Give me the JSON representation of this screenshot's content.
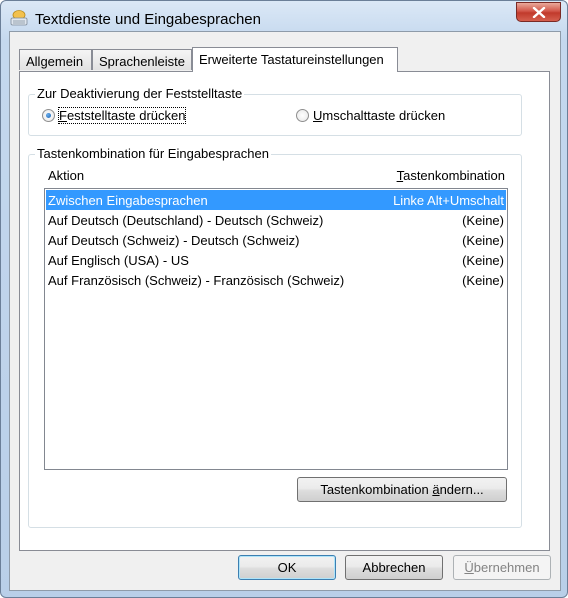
{
  "window": {
    "title": "Textdienste und Eingabesprachen"
  },
  "tabs": [
    {
      "label": "Allgemein",
      "active": false
    },
    {
      "label": "Sprachenleiste",
      "active": false
    },
    {
      "label": "Erweiterte Tastatureinstellungen",
      "active": true
    }
  ],
  "capslock_group": {
    "title": "Zur Deaktivierung der Feststelltaste",
    "option1": {
      "pre": "",
      "ul": "F",
      "post": "eststelltaste drücken",
      "selected": true
    },
    "option2": {
      "pre": "",
      "ul": "U",
      "post": "mschalttaste drücken",
      "selected": false
    }
  },
  "hotkey_group": {
    "title": "Tastenkombination für Eingabesprachen",
    "col_action": "Aktion",
    "col_key": {
      "ul": "T",
      "post": "astenkombination"
    },
    "rows": [
      {
        "action": "Zwischen Eingabesprachen",
        "key": "Linke Alt+Umschalt",
        "selected": true
      },
      {
        "action": "Auf Deutsch (Deutschland) - Deutsch (Schweiz)",
        "key": "(Keine)",
        "selected": false
      },
      {
        "action": "Auf Deutsch (Schweiz) - Deutsch (Schweiz)",
        "key": "(Keine)",
        "selected": false
      },
      {
        "action": "Auf Englisch (USA) - US",
        "key": "(Keine)",
        "selected": false
      },
      {
        "action": "Auf Französisch (Schweiz) - Französisch (Schweiz)",
        "key": "(Keine)",
        "selected": false
      }
    ],
    "change_button": {
      "pre": "Tastenkombination ",
      "ul": "ä",
      "post": "ndern..."
    }
  },
  "buttons": {
    "ok": "OK",
    "cancel": "Abbrechen",
    "apply": {
      "ul": "Ü",
      "post": "bernehmen",
      "enabled": false
    }
  },
  "colors": {
    "selection": "#3399ff",
    "close_button": "#c13a2c"
  }
}
